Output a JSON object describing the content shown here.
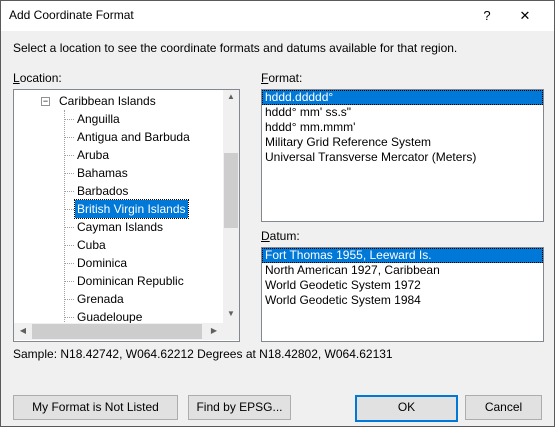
{
  "window": {
    "title": "Add Coordinate Format",
    "help_glyph": "?",
    "close_glyph": "✕"
  },
  "instruction": "Select a location to see the coordinate formats and datums available for that region.",
  "location": {
    "label_key": "L",
    "label_rest": "ocation:",
    "tree": [
      {
        "label": "Caribbean Islands",
        "level": 0,
        "expanded": true
      },
      {
        "label": "Anguilla",
        "level": 1
      },
      {
        "label": "Antigua and Barbuda",
        "level": 1
      },
      {
        "label": "Aruba",
        "level": 1
      },
      {
        "label": "Bahamas",
        "level": 1
      },
      {
        "label": "Barbados",
        "level": 1
      },
      {
        "label": "British Virgin Islands",
        "level": 1,
        "selected": true
      },
      {
        "label": "Cayman Islands",
        "level": 1
      },
      {
        "label": "Cuba",
        "level": 1
      },
      {
        "label": "Dominica",
        "level": 1
      },
      {
        "label": "Dominican Republic",
        "level": 1
      },
      {
        "label": "Grenada",
        "level": 1
      },
      {
        "label": "Guadeloupe",
        "level": 1
      }
    ],
    "toggle_glyph": "−",
    "scroll_up": "▲",
    "scroll_down": "▼",
    "scroll_left": "◀",
    "scroll_right": "▶"
  },
  "format": {
    "label_key": "F",
    "label_rest": "ormat:",
    "items": [
      {
        "label": "hddd.ddddd°",
        "selected": true
      },
      {
        "label": "hddd° mm' ss.s\""
      },
      {
        "label": "hddd° mm.mmm'"
      },
      {
        "label": "Military Grid Reference System"
      },
      {
        "label": "Universal Transverse Mercator (Meters)"
      }
    ]
  },
  "datum": {
    "label_key": "D",
    "label_rest": "atum:",
    "items": [
      {
        "label": "Fort Thomas 1955, Leeward Is.",
        "selected": true
      },
      {
        "label": "North American 1927, Caribbean"
      },
      {
        "label": "World Geodetic System 1972"
      },
      {
        "label": "World Geodetic System 1984"
      }
    ]
  },
  "sample": "Sample: N18.42742, W064.62212 Degrees at N18.42802, W064.62131",
  "buttons": {
    "not_listed": "My Format is Not Listed",
    "find_epsg": "Find by EPSG...",
    "ok": "OK",
    "cancel": "Cancel"
  },
  "colors": {
    "selection": "#0078d7",
    "dialog_bg": "#f0f0f0"
  }
}
